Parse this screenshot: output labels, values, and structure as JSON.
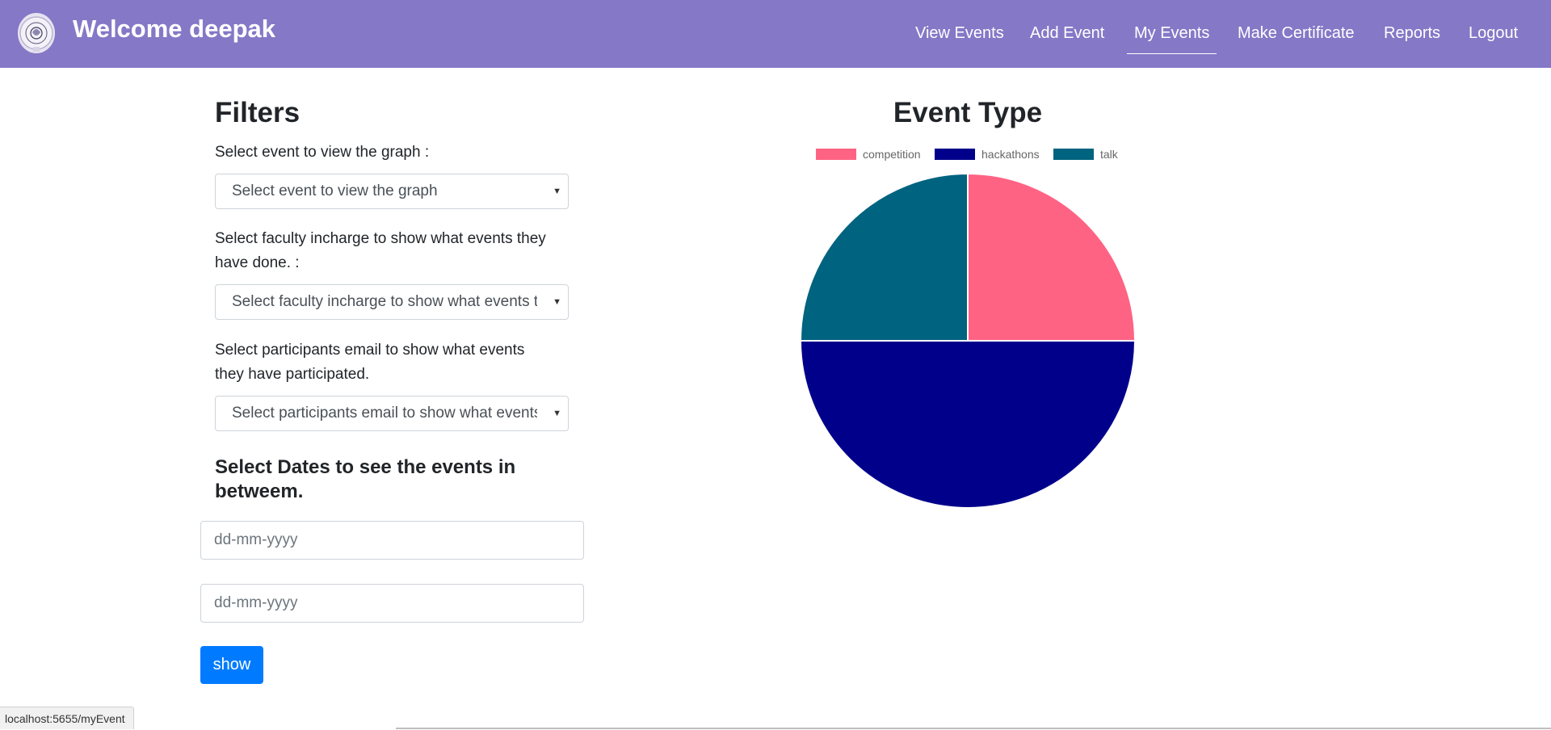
{
  "navbar": {
    "brand": "Welcome deepak",
    "items": [
      {
        "label": "View Events"
      },
      {
        "label": "Add Event"
      },
      {
        "label": "My Events",
        "active": true
      },
      {
        "label": "Make Certificate"
      },
      {
        "label": "Reports"
      },
      {
        "label": "Logout"
      }
    ],
    "background_color": "#8578c7"
  },
  "filters": {
    "title": "Filters",
    "event_label": "Select event to view the graph :",
    "event_select": "Select event to view the graph",
    "faculty_label_line1": "Select faculty incharge to show what events they",
    "faculty_label_line2": "have done. :",
    "faculty_select": "Select faculty incharge to show what events they have done.",
    "participant_label_line1": "Select participants email to show what events",
    "participant_label_line2": "they have participated.",
    "participant_select": "Select participants email to show what events they have participated.",
    "dates_heading_line1": "Select Dates to see the events in",
    "dates_heading_line2": "betweem.",
    "date_from_placeholder": "dd-mm-yyyy",
    "date_to_placeholder": "dd-mm-yyyy",
    "show_button": "show",
    "button_color": "#007bff"
  },
  "chart_data": {
    "type": "pie",
    "title": "Event Type",
    "legend_position": "top",
    "categories": [
      "competition",
      "hackathons",
      "talk"
    ],
    "values": [
      1,
      2,
      1
    ],
    "colors": [
      "#ff6384",
      "#00008b",
      "#00637f"
    ]
  },
  "status_bar": {
    "url": "localhost:5655/myEvent"
  }
}
